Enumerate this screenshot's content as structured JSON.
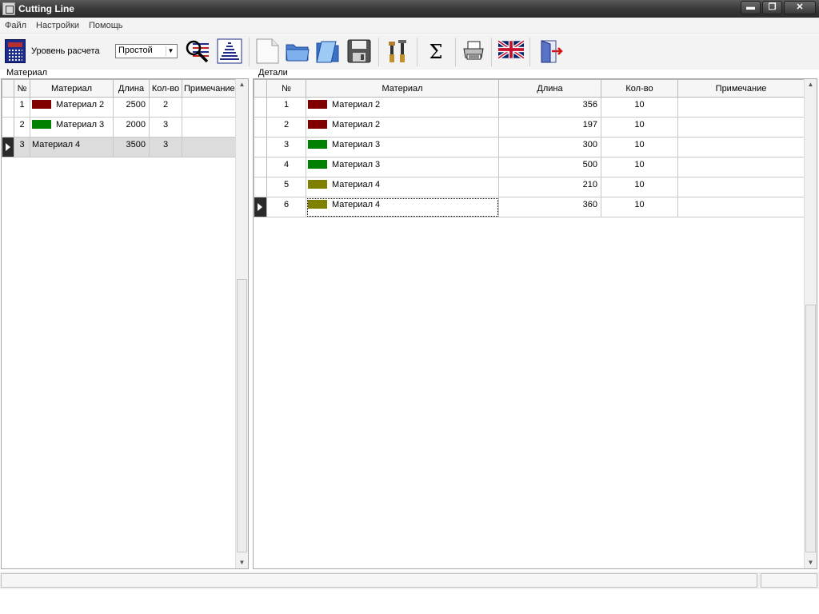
{
  "window": {
    "title": "Cutting Line",
    "min": "▬",
    "max": "❐",
    "close": "✕"
  },
  "menu": [
    "Файл",
    "Настройки",
    "Помощь"
  ],
  "toolbar": {
    "level_label": "Уровень расчета",
    "level_value": "Простой",
    "icons": [
      "calculator-icon",
      "search-details-icon",
      "pyramid-sort-icon",
      "new-file-icon",
      "open-folder-icon",
      "open-file-icon",
      "save-icon",
      "tools-icon",
      "sum-icon",
      "print-icon",
      "language-uk-flag-icon",
      "exit-door-icon"
    ],
    "sum_glyph": "Σ"
  },
  "materials": {
    "section_label": "Материал",
    "columns": [
      "№",
      "Материал",
      "Длина",
      "Кол-во",
      "Примечание"
    ],
    "rows": [
      {
        "n": "1",
        "name": "Материал 2",
        "color": "#800000",
        "length": "2500",
        "qty": "2",
        "note": ""
      },
      {
        "n": "2",
        "name": "Материал 3",
        "color": "#008000",
        "length": "2000",
        "qty": "3",
        "note": ""
      },
      {
        "n": "3",
        "name": "Материал 4",
        "color": "",
        "length": "3500",
        "qty": "3",
        "note": ""
      }
    ],
    "selected_row": 2
  },
  "details": {
    "section_label": "Детали",
    "columns": [
      "№",
      "Материал",
      "Длина",
      "Кол-во",
      "Примечание"
    ],
    "rows": [
      {
        "n": "1",
        "name": "Материал 2",
        "color": "#800000",
        "length": "356",
        "qty": "10",
        "note": ""
      },
      {
        "n": "2",
        "name": "Материал 2",
        "color": "#800000",
        "length": "197",
        "qty": "10",
        "note": ""
      },
      {
        "n": "3",
        "name": "Материал 3",
        "color": "#008000",
        "length": "300",
        "qty": "10",
        "note": ""
      },
      {
        "n": "4",
        "name": "Материал 3",
        "color": "#008000",
        "length": "500",
        "qty": "10",
        "note": ""
      },
      {
        "n": "5",
        "name": "Материал 4",
        "color": "#808000",
        "length": "210",
        "qty": "10",
        "note": ""
      },
      {
        "n": "6",
        "name": "Материал 4",
        "color": "#808000",
        "length": "360",
        "qty": "10",
        "note": ""
      }
    ],
    "selected_row": 5
  },
  "colors": {
    "titlebar": "#3a3a3a",
    "material2": "#800000",
    "material3": "#008000",
    "material4": "#808000"
  }
}
